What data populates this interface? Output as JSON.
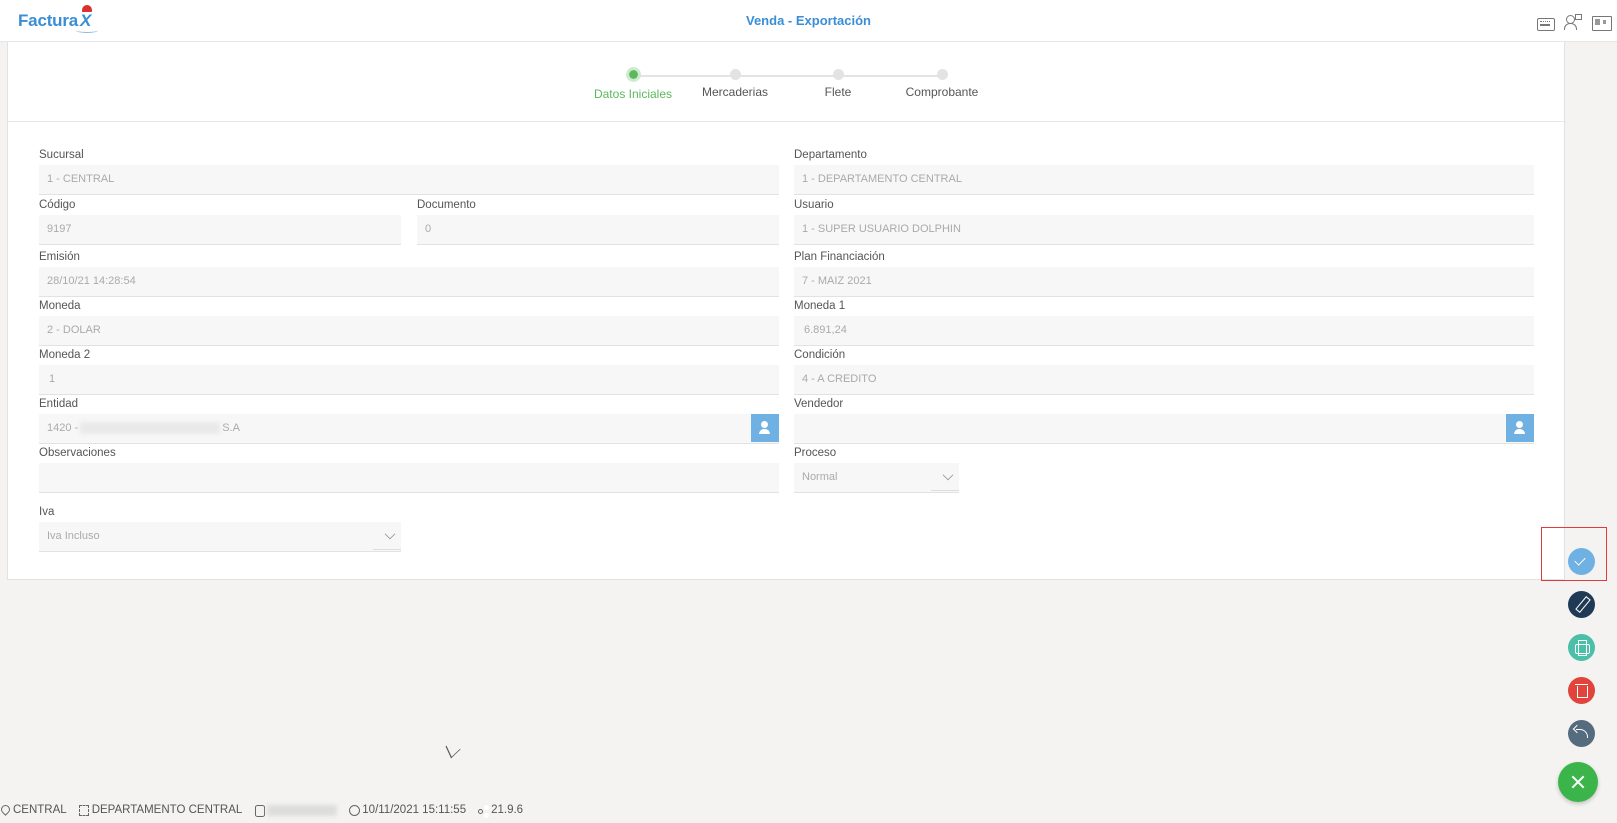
{
  "header": {
    "logo_text": "Factura",
    "logo_mark": "X",
    "title": "Venda - Exportación",
    "icons": [
      "keyboard-icon",
      "users-icon",
      "id-card-icon"
    ]
  },
  "stepper": {
    "steps": [
      {
        "label": "Datos Iniciales",
        "active": true
      },
      {
        "label": "Mercaderias",
        "active": false
      },
      {
        "label": "Flete",
        "active": false
      },
      {
        "label": "Comprobante",
        "active": false
      }
    ]
  },
  "form": {
    "sucursal": {
      "label": "Sucursal",
      "value": "1 - CENTRAL"
    },
    "departamento": {
      "label": "Departamento",
      "value": "1 - DEPARTAMENTO CENTRAL"
    },
    "codigo": {
      "label": "Código",
      "value": "9197"
    },
    "documento": {
      "label": "Documento",
      "value": "0"
    },
    "usuario": {
      "label": "Usuario",
      "value": "1 - SUPER USUARIO DOLPHIN"
    },
    "emision": {
      "label": "Emisión",
      "value": "28/10/21 14:28:54"
    },
    "plan_financiacion": {
      "label": "Plan Financiación",
      "value": "7 - MAIZ 2021"
    },
    "moneda": {
      "label": "Moneda",
      "value": "2 - DOLAR"
    },
    "moneda1": {
      "label": "Moneda 1",
      "value": "6.891,24"
    },
    "moneda2": {
      "label": "Moneda 2",
      "value": "1"
    },
    "condicion": {
      "label": "Condición",
      "value": "4 - A CREDITO"
    },
    "entidad": {
      "label": "Entidad",
      "value_prefix": "1420 -",
      "value_suffix": "S.A"
    },
    "vendedor": {
      "label": "Vendedor",
      "value": ""
    },
    "observaciones": {
      "label": "Observaciones",
      "value": ""
    },
    "proceso": {
      "label": "Proceso",
      "value": "Normal"
    },
    "iva": {
      "label": "Iva",
      "value": "Iva Incluso"
    }
  },
  "actions": [
    "confirm-button",
    "edit-button",
    "print-button",
    "delete-button",
    "back-button",
    "close-button"
  ],
  "status_bar": {
    "sucursal": "CENTRAL",
    "departamento": "DEPARTAMENTO CENTRAL",
    "datetime": "10/11/2021 15:11:55",
    "version": "21.9.6"
  },
  "colors": {
    "accent": "#3a8ed6",
    "step_active": "#5cb85c",
    "confirm": "#6fb1e2",
    "edit": "#203a55",
    "print": "#4bbfa8",
    "delete": "#e0443a",
    "back": "#556b7e",
    "close": "#3bb54a",
    "highlight": "#e23b3b"
  }
}
